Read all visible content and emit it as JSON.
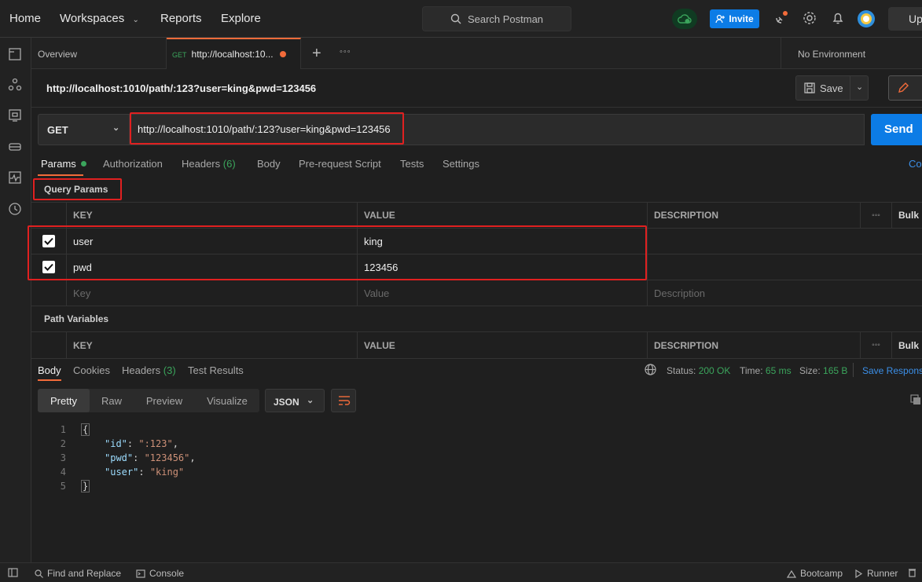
{
  "topbar": {
    "nav": [
      "Home",
      "Workspaces",
      "Reports",
      "Explore"
    ],
    "search_placeholder": "Search Postman",
    "invite_label": "Invite",
    "upgrade_label": "Up"
  },
  "tabs": {
    "overview": "Overview",
    "active": {
      "method": "GET",
      "title": "http://localhost:10..."
    },
    "environment": "No Environment"
  },
  "request": {
    "title": "http://localhost:1010/path/:123?user=king&pwd=123456",
    "save_label": "Save",
    "method": "GET",
    "url": "http://localhost:1010/path/:123?user=king&pwd=123456",
    "send_label": "Send"
  },
  "param_tabs": {
    "params": "Params",
    "authorization": "Authorization",
    "headers": "Headers",
    "headers_count": "(6)",
    "body": "Body",
    "prerequest": "Pre-request Script",
    "tests": "Tests",
    "settings": "Settings",
    "cookies_partial": "Co"
  },
  "query_params": {
    "label": "Query Params",
    "columns": {
      "key": "KEY",
      "value": "VALUE",
      "description": "DESCRIPTION",
      "bulk": "Bulk E"
    },
    "rows": [
      {
        "key": "user",
        "value": "king",
        "checked": true
      },
      {
        "key": "pwd",
        "value": "123456",
        "checked": true
      }
    ],
    "placeholders": {
      "key": "Key",
      "value": "Value",
      "description": "Description"
    }
  },
  "path_variables": {
    "label": "Path Variables",
    "columns": {
      "key": "KEY",
      "value": "VALUE",
      "description": "DESCRIPTION",
      "bulk": "Bulk E"
    }
  },
  "response": {
    "tabs": {
      "body": "Body",
      "cookies": "Cookies",
      "headers": "Headers",
      "headers_count": "(3)",
      "test_results": "Test Results"
    },
    "status_label": "Status:",
    "status_value": "200 OK",
    "time_label": "Time:",
    "time_value": "65 ms",
    "size_label": "Size:",
    "size_value": "165 B",
    "save_response": "Save Response",
    "views": [
      "Pretty",
      "Raw",
      "Preview",
      "Visualize"
    ],
    "format": "JSON",
    "line_numbers": [
      "1",
      "2",
      "3",
      "4",
      "5"
    ],
    "body": {
      "open": "{",
      "id_key": "\"id\"",
      "id_val": "\":123\"",
      "pwd_key": "\"pwd\"",
      "pwd_val": "\"123456\"",
      "user_key": "\"user\"",
      "user_val": "\"king\"",
      "close": "}"
    }
  },
  "statusbar": {
    "find_replace": "Find and Replace",
    "console": "Console",
    "bootcamp": "Bootcamp",
    "runner": "Runner"
  },
  "colors": {
    "accent_orange": "#f26b3a",
    "send_blue": "#0c7ce6",
    "status_green": "#3ba55c",
    "annotation_red": "#e02020"
  }
}
